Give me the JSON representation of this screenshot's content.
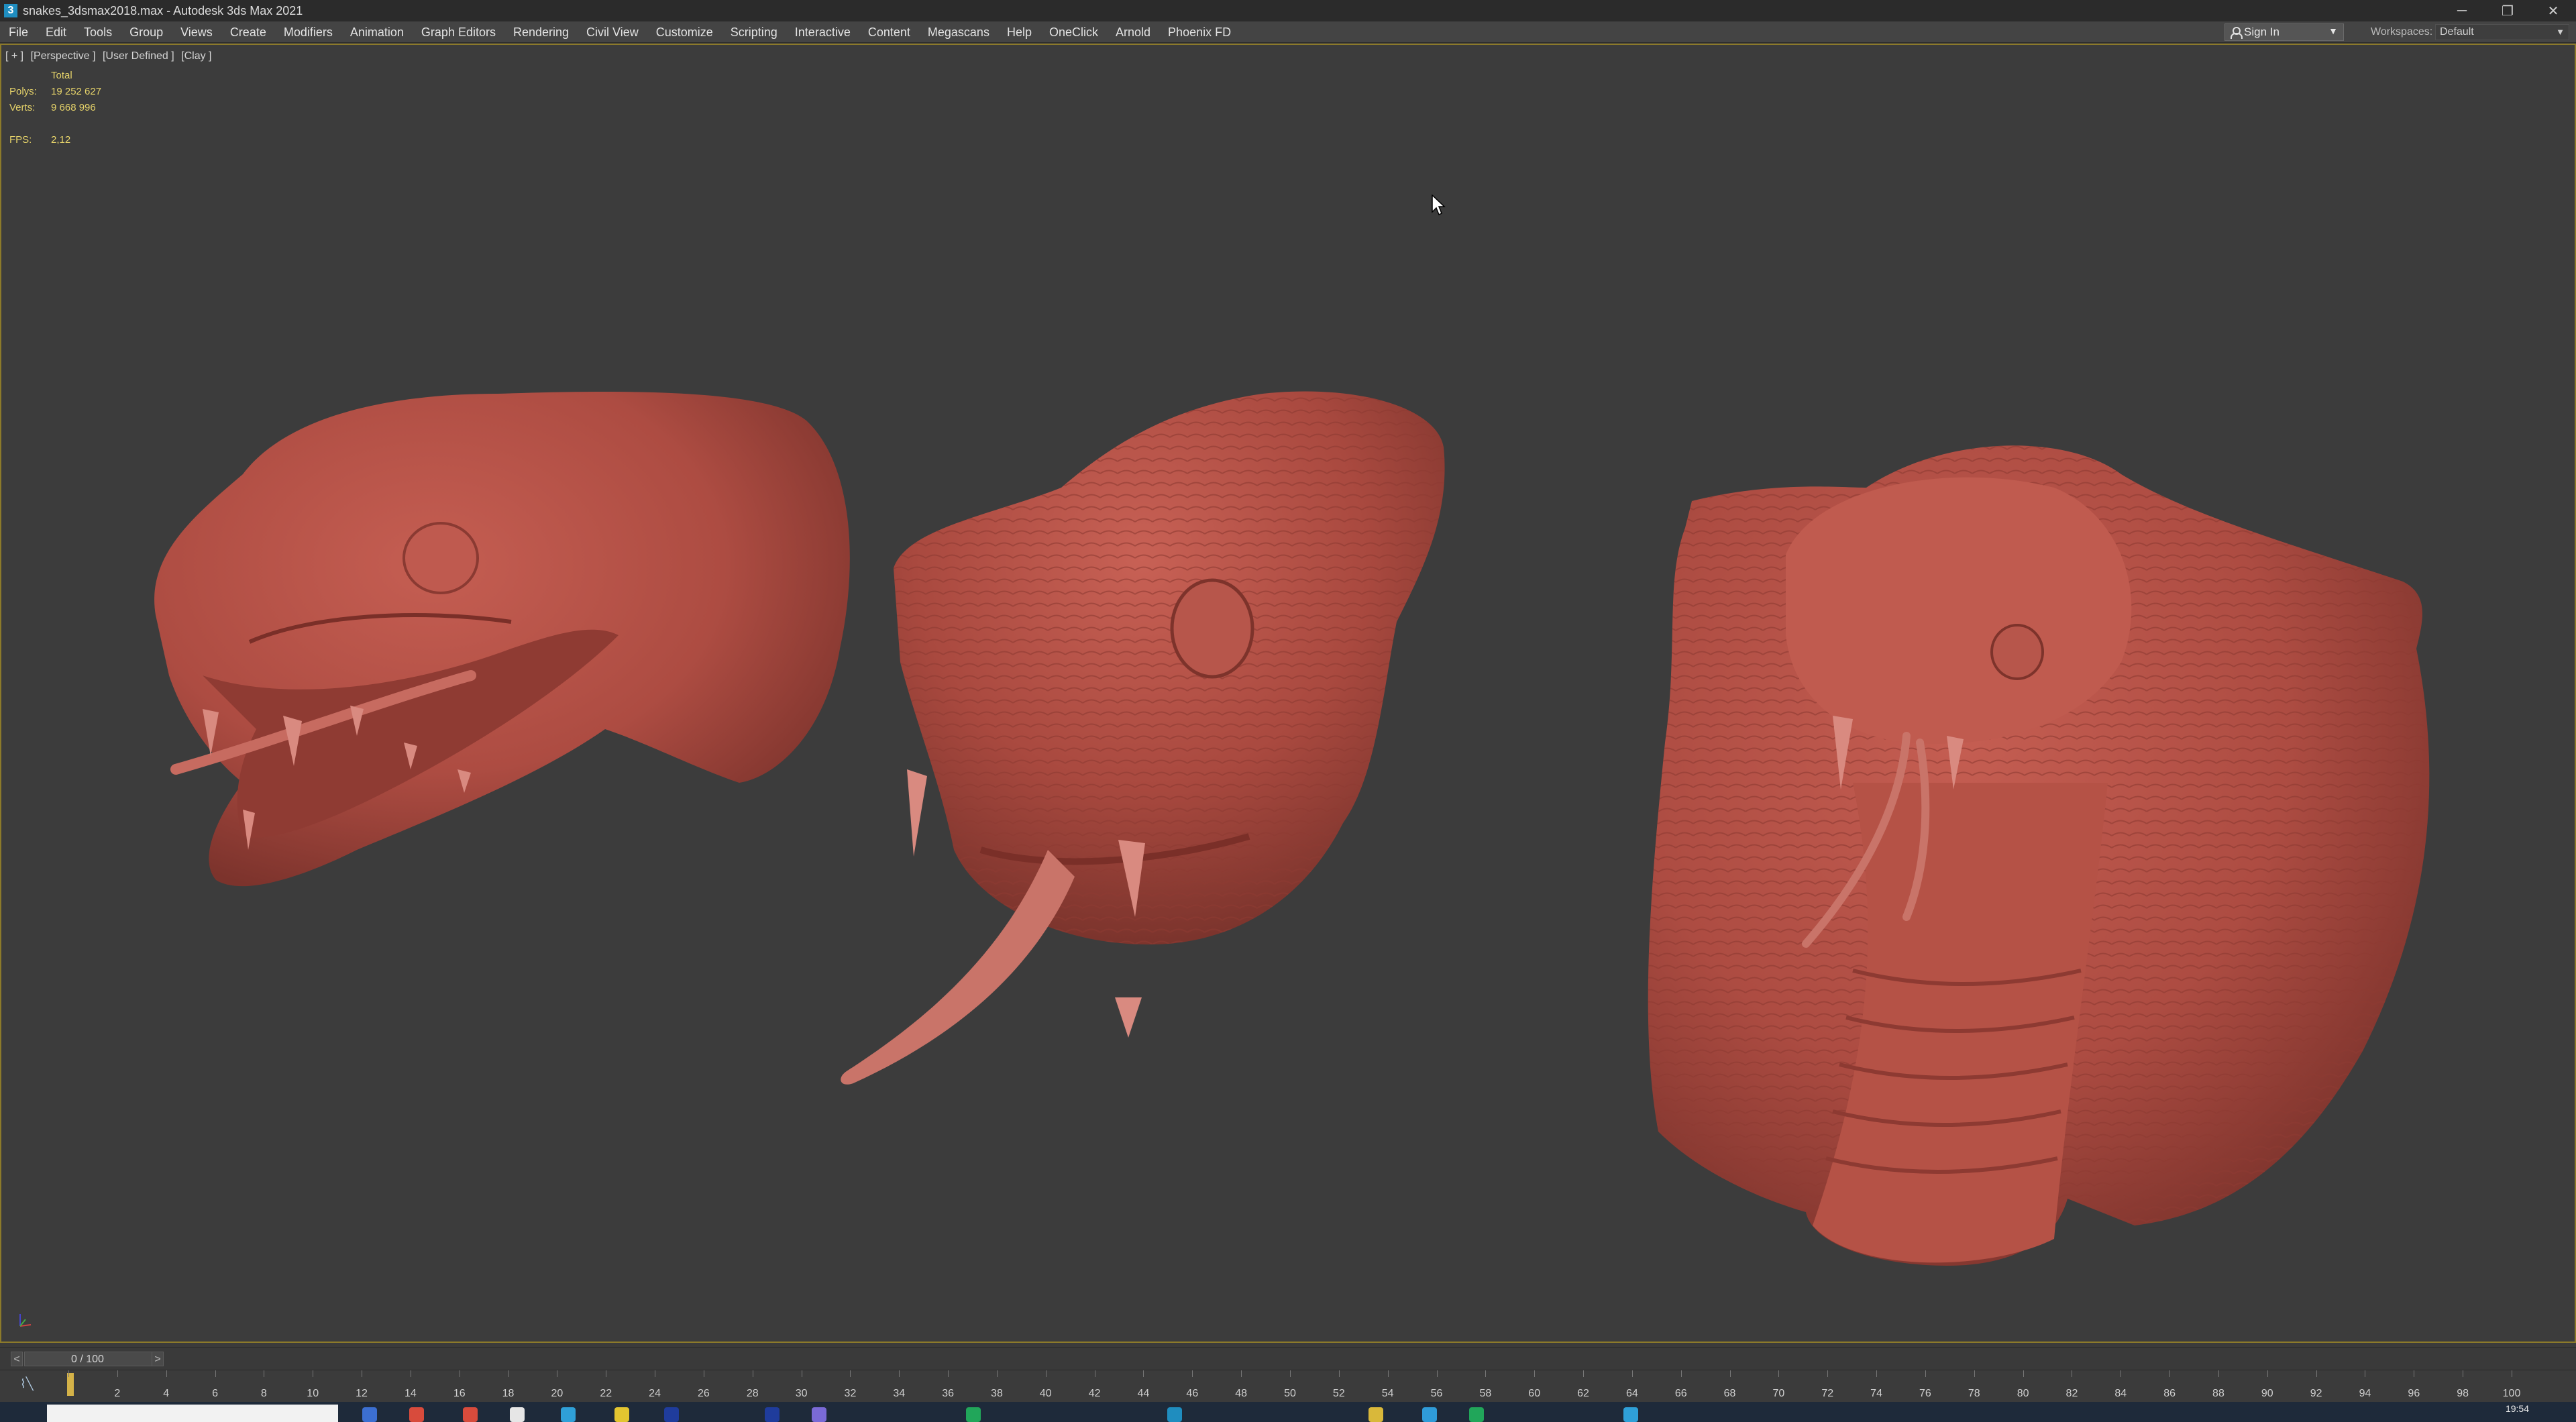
{
  "window": {
    "title": "snakes_3dsmax2018.max - Autodesk 3ds Max 2021",
    "minimize_glyph": "─",
    "restore_glyph": "❐",
    "close_glyph": "✕"
  },
  "menu": {
    "items": [
      "File",
      "Edit",
      "Tools",
      "Group",
      "Views",
      "Create",
      "Modifiers",
      "Animation",
      "Graph Editors",
      "Rendering",
      "Civil View",
      "Customize",
      "Scripting",
      "Interactive",
      "Content",
      "Megascans",
      "Help",
      "OneClick",
      "Arnold",
      "Phoenix FD"
    ],
    "sign_in": "Sign In",
    "workspaces_label": "Workspaces:",
    "workspaces_value": "Default"
  },
  "viewport": {
    "labels": [
      "[ + ]",
      "[Perspective ]",
      "[User Defined ]",
      "[Clay ]"
    ],
    "stats": {
      "total_label": "Total",
      "polys_label": "Polys:",
      "polys_value": "19 252 627",
      "verts_label": "Verts:",
      "verts_value": "9 668 996",
      "fps_label": "FPS:",
      "fps_value": "2,12"
    },
    "model_color": "#b24f45",
    "background_color": "#3c3c3c"
  },
  "timeslider": {
    "value": "0 / 100",
    "prev": "<",
    "next": ">"
  },
  "trackbar": {
    "ticks": [
      0,
      2,
      4,
      6,
      8,
      10,
      12,
      14,
      16,
      18,
      20,
      22,
      24,
      26,
      28,
      30,
      32,
      34,
      36,
      38,
      40,
      42,
      44,
      46,
      48,
      50,
      52,
      54,
      56,
      58,
      60,
      62,
      64,
      66,
      68,
      70,
      72,
      74,
      76,
      78,
      80,
      82,
      84,
      86,
      88,
      90,
      92,
      94,
      96,
      98,
      100
    ],
    "current_frame": 0,
    "total_frames": 100
  },
  "taskbar": {
    "time": "19:54"
  }
}
